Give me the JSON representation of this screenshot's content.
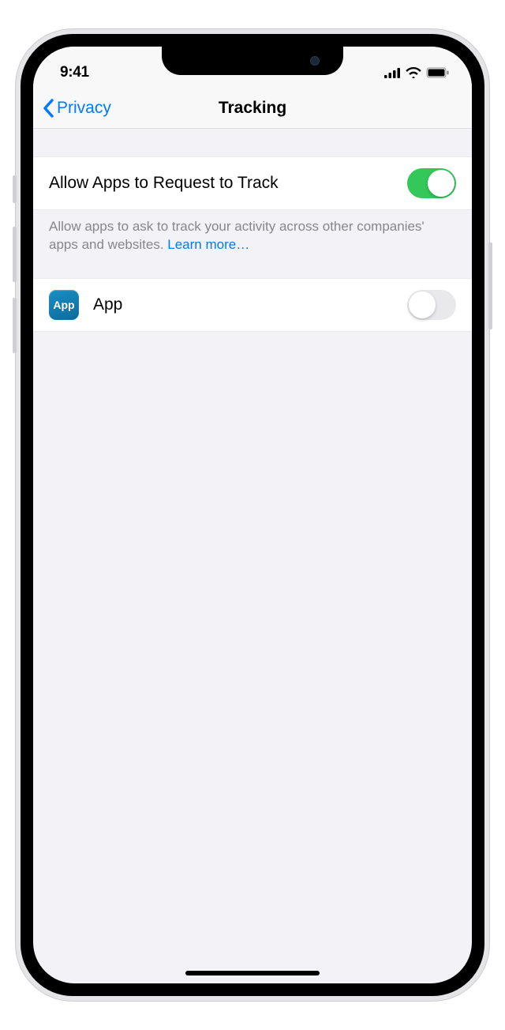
{
  "status": {
    "time": "9:41"
  },
  "nav": {
    "back_label": "Privacy",
    "title": "Tracking"
  },
  "main_toggle": {
    "label": "Allow Apps to Request to Track",
    "enabled": true
  },
  "footer": {
    "text": "Allow apps to ask to track your activity across other companies' apps and websites. ",
    "link_text": "Learn more…"
  },
  "app_row": {
    "icon_text": "App",
    "label": "App",
    "enabled": false
  }
}
